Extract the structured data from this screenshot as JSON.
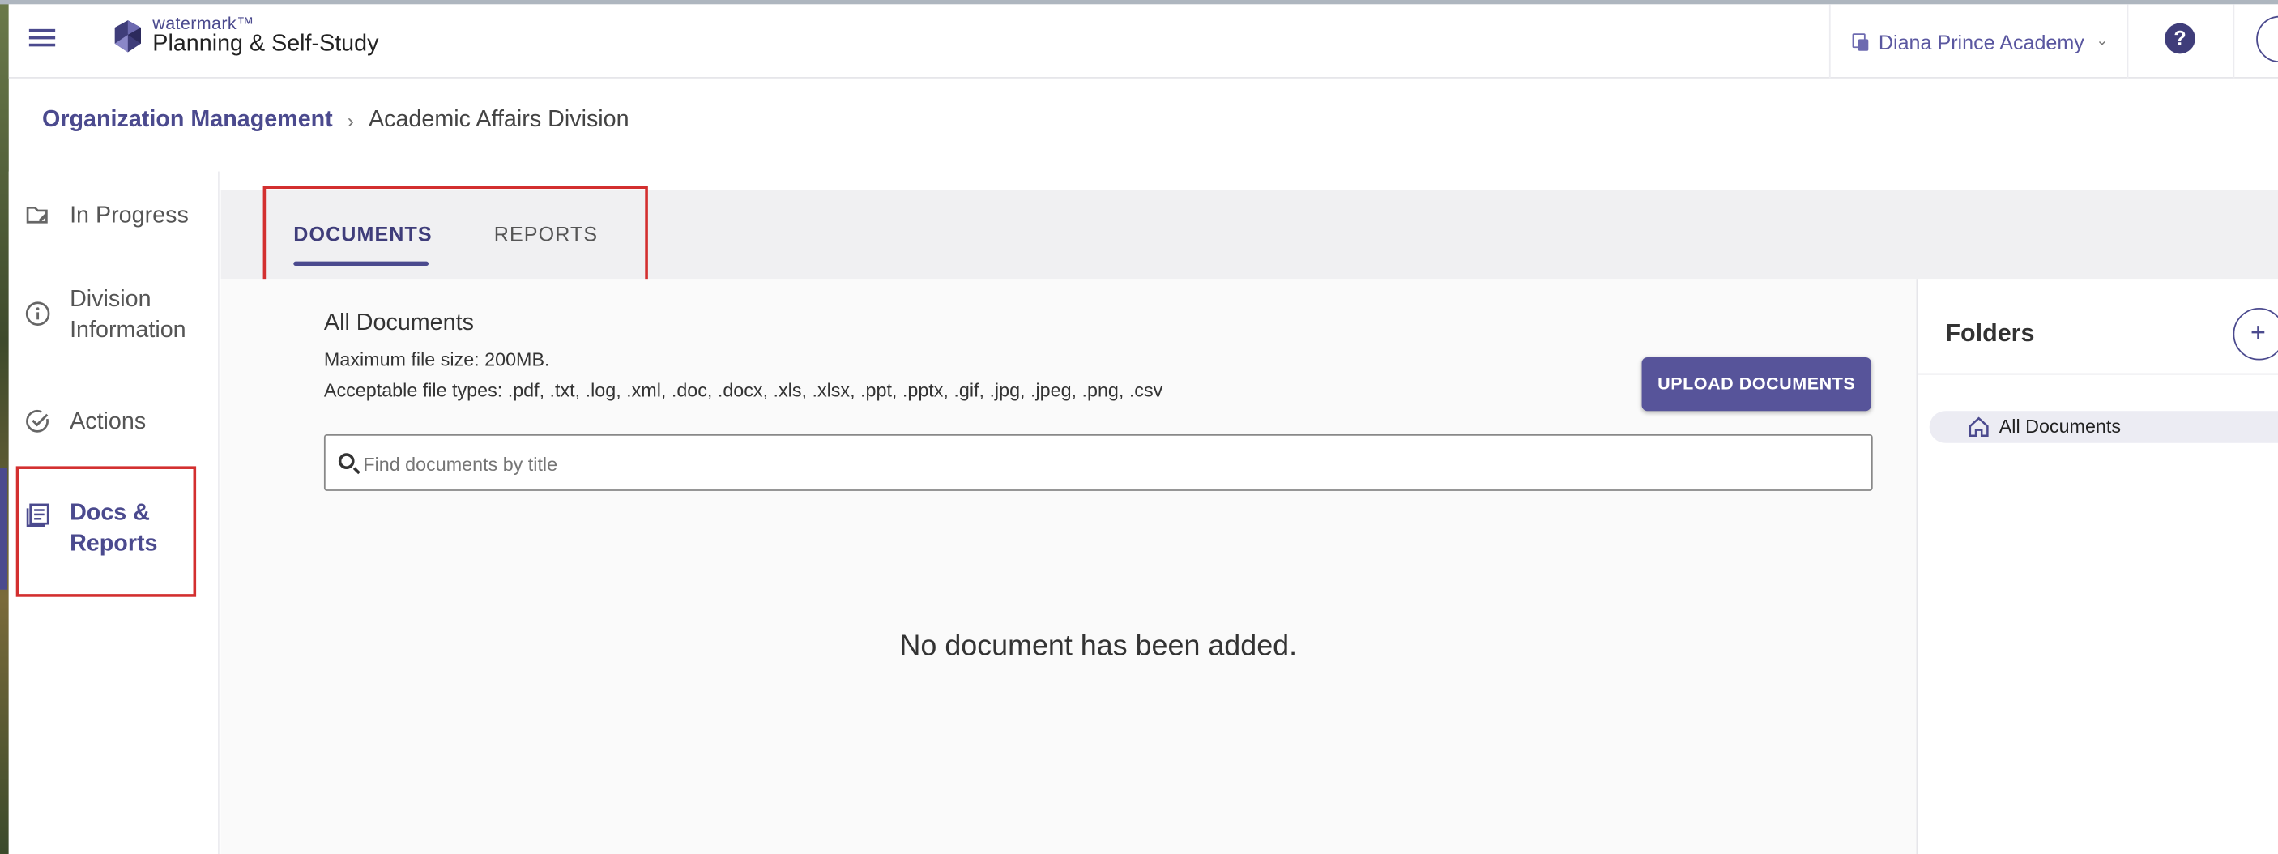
{
  "header": {
    "brand_small": "watermark™",
    "brand_main": "Planning & Self-Study",
    "org_name": "Diana Prince Academy",
    "help_label": "?"
  },
  "breadcrumb": {
    "root": "Organization Management",
    "separator": "›",
    "current": "Academic Affairs Division"
  },
  "sidebar": {
    "items": [
      {
        "label": "In Progress",
        "icon": "folder-edit-icon"
      },
      {
        "label": "Division Information",
        "icon": "info-icon"
      },
      {
        "label": "Actions",
        "icon": "check-circle-icon"
      },
      {
        "label": "Docs & Reports",
        "icon": "documents-icon",
        "active": true
      }
    ]
  },
  "tabs": [
    {
      "label": "DOCUMENTS",
      "active": true
    },
    {
      "label": "REPORTS",
      "active": false
    }
  ],
  "documents": {
    "title": "All Documents",
    "max_size": "Maximum file size: 200MB.",
    "file_types": "Acceptable file types: .pdf, .txt, .log, .xml, .doc, .docx, .xls, .xlsx, .ppt, .pptx, .gif, .jpg, .jpeg, .png, .csv",
    "upload_label": "UPLOAD DOCUMENTS",
    "search_placeholder": "Find documents by title",
    "empty_message": "No document has been added."
  },
  "folders": {
    "title": "Folders",
    "add_label": "+",
    "items": [
      {
        "label": "All Documents"
      }
    ]
  },
  "colors": {
    "accent": "#4b4a8e",
    "highlight_box": "#d32f2f"
  }
}
